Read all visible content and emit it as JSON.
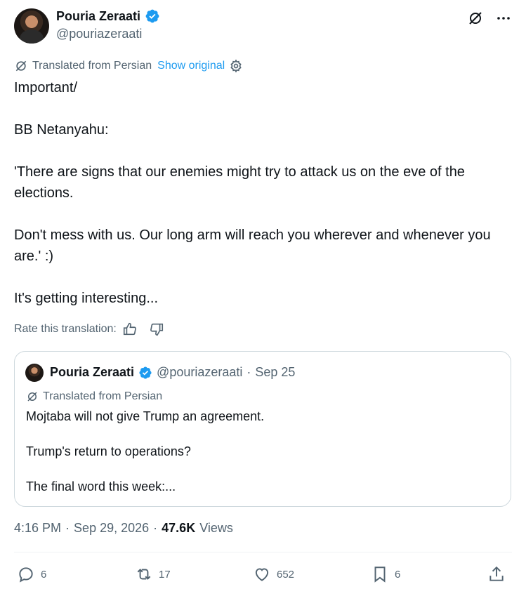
{
  "author": {
    "display_name": "Pouria Zeraati",
    "handle": "@pouriazeraati"
  },
  "translation": {
    "notice": "Translated from Persian",
    "show_original": "Show original",
    "rate_label": "Rate this translation:"
  },
  "tweet": {
    "text": "Important/\n\nBB Netanyahu:\n\n'There are signs that our enemies might try to attack us on the eve of the elections.\n\nDon't mess with us. Our long arm will reach you wherever and whenever you are.' :)\n\nIt's getting interesting..."
  },
  "quote": {
    "display_name": "Pouria Zeraati",
    "handle": "@pouriazeraati",
    "separator": "·",
    "date": "Sep 25",
    "translated_notice": "Translated from Persian",
    "text": "Mojtaba will not give Trump an agreement.\n\nTrump's return to operations?\n\nThe final word this week:..."
  },
  "meta": {
    "time": "4:16 PM",
    "separator": "·",
    "date": "Sep 29, 2026",
    "views_count": "47.6K",
    "views_label": "Views"
  },
  "actions": {
    "replies": "6",
    "reposts": "17",
    "likes": "652",
    "bookmarks": "6"
  },
  "colors": {
    "accent": "#1d9bf0",
    "text": "#0f1419",
    "muted": "#536471",
    "border": "#cfd9de"
  }
}
